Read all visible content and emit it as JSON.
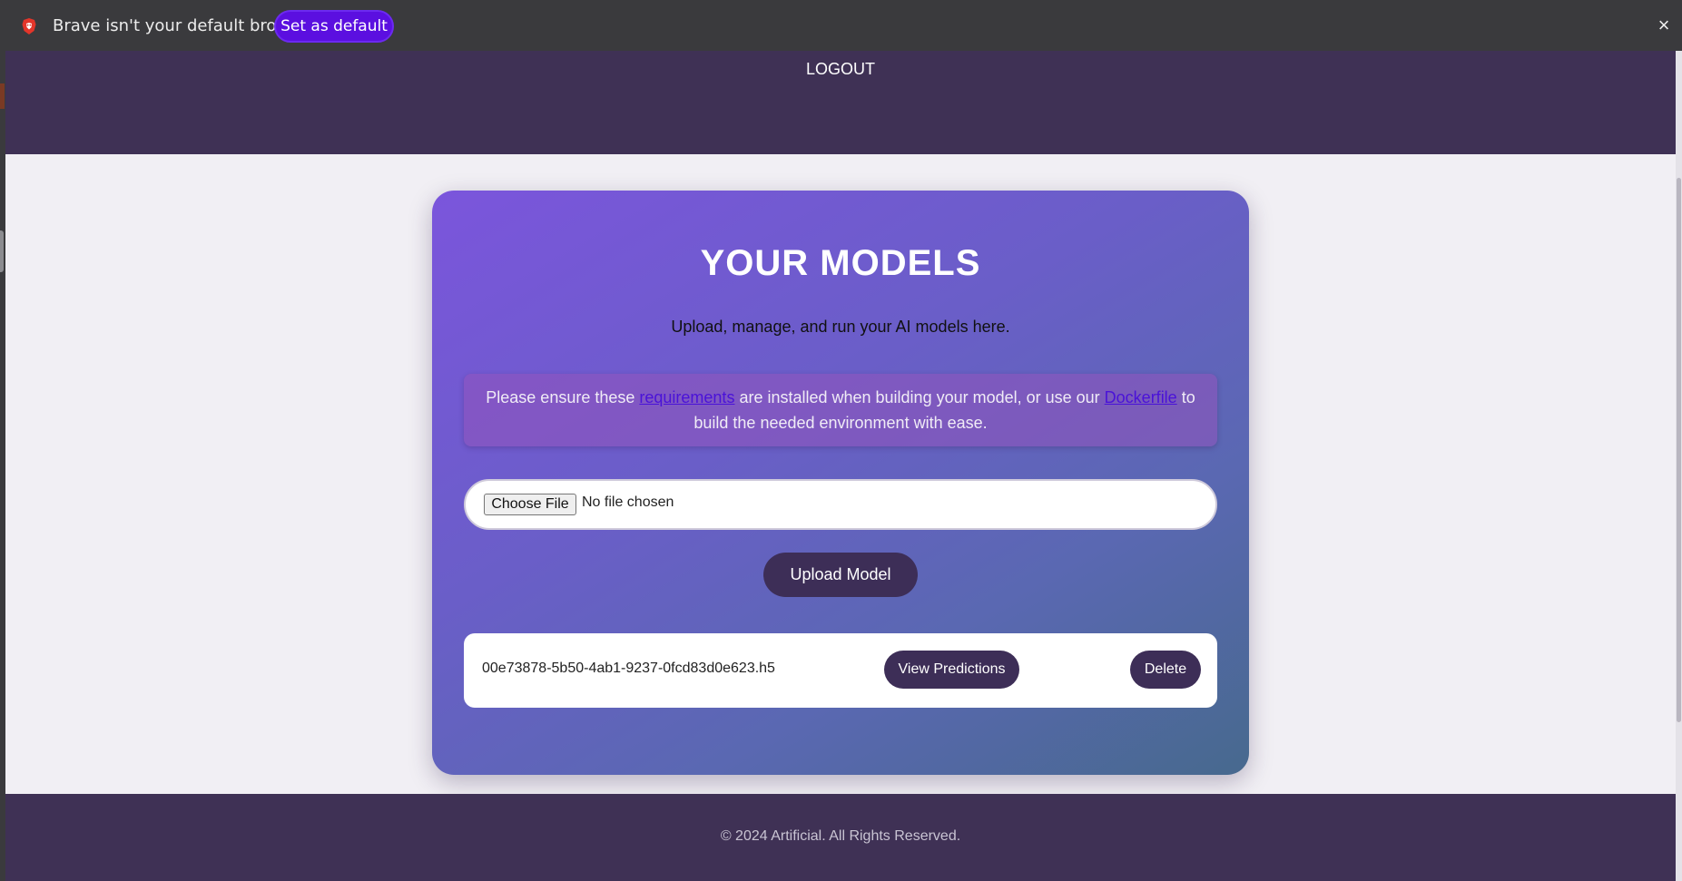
{
  "browser": {
    "infobar_message": "Brave isn't your default browser",
    "set_default_label": "Set as default",
    "close_symbol": "×",
    "accent_color": "#5b0fe0"
  },
  "header": {
    "logout_label": "LOGOUT",
    "background_color": "#3f3155"
  },
  "main": {
    "title": "YOUR MODELS",
    "subtitle": "Upload, manage, and run your AI models here.",
    "notice": {
      "text_before": "Please ensure these ",
      "requirements_link": "requirements",
      "text_middle": " are installed when building your model, or use our ",
      "dockerfile_link": "Dockerfile",
      "text_after": " to build the needed environment with ease."
    },
    "file_input": {
      "button_label": "Choose File",
      "status": "No file chosen"
    },
    "upload_button_label": "Upload Model",
    "models": [
      {
        "filename": "00e73878-5b50-4ab1-9237-0fcd83d0e623.h5",
        "view_label": "View Predictions",
        "delete_label": "Delete"
      }
    ]
  },
  "footer": {
    "text": "© 2024 Artificial. All Rights Reserved."
  }
}
